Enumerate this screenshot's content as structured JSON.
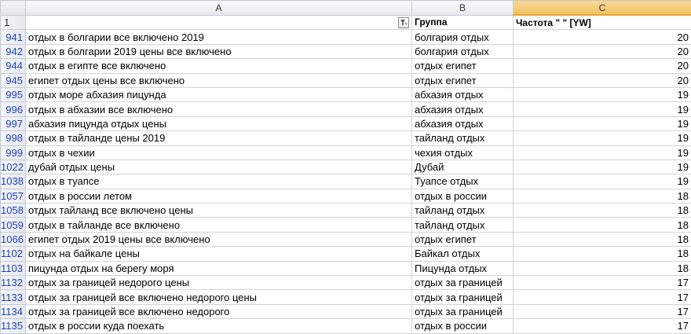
{
  "columns": [
    "A",
    "B",
    "C"
  ],
  "header_row": {
    "row_number": "1",
    "a": "",
    "b": "Группа",
    "c": "Частота \" \" [YW]"
  },
  "rows": [
    {
      "n": "941",
      "a": "отдых в болгарии все включено 2019",
      "b": "болгария отдых",
      "c": "20"
    },
    {
      "n": "942",
      "a": "отдых в болгарии 2019 цены все включено",
      "b": "болгария отдых",
      "c": "20"
    },
    {
      "n": "944",
      "a": "отдых в египте все включено",
      "b": "отдых египет",
      "c": "20"
    },
    {
      "n": "945",
      "a": "египет отдых цены все включено",
      "b": "отдых египет",
      "c": "20"
    },
    {
      "n": "995",
      "a": "отдых море абхазия пицунда",
      "b": "абхазия отдых",
      "c": "19"
    },
    {
      "n": "996",
      "a": "отдых в абхазии все включено",
      "b": "абхазия отдых",
      "c": "19"
    },
    {
      "n": "997",
      "a": "абхазия пицунда отдых цены",
      "b": "абхазия отдых",
      "c": "19"
    },
    {
      "n": "998",
      "a": "отдых в тайланде цены 2019",
      "b": "тайланд отдых",
      "c": "19"
    },
    {
      "n": "999",
      "a": "отдых в чехии",
      "b": "чехия отдых",
      "c": "19"
    },
    {
      "n": "1022",
      "a": "дубай отдых цены",
      "b": "Дубай",
      "c": "19"
    },
    {
      "n": "1038",
      "a": "отдых в туапсе",
      "b": "Туапсе отдых",
      "c": "19"
    },
    {
      "n": "1057",
      "a": "отдых в россии летом",
      "b": "отдых в россии",
      "c": "18"
    },
    {
      "n": "1058",
      "a": "отдых тайланд все включено цены",
      "b": "тайланд отдых",
      "c": "18"
    },
    {
      "n": "1059",
      "a": "отдых в тайланде все включено",
      "b": "тайланд отдых",
      "c": "18"
    },
    {
      "n": "1066",
      "a": "египет отдых 2019 цены все включено",
      "b": "отдых египет",
      "c": "18"
    },
    {
      "n": "1102",
      "a": "отдых на байкале цены",
      "b": "Байкал отдых",
      "c": "18"
    },
    {
      "n": "1103",
      "a": "пицунда отдых на берегу моря",
      "b": "Пицунда отдых",
      "c": "18"
    },
    {
      "n": "1132",
      "a": "отдых за границей недорого цены",
      "b": "отдых за границей",
      "c": "17"
    },
    {
      "n": "1133",
      "a": "отдых за границей все включено недорого цены",
      "b": "отдых за границей",
      "c": "17"
    },
    {
      "n": "1134",
      "a": "отдых за границей все включено недорого",
      "b": "отдых за границей",
      "c": "17"
    },
    {
      "n": "1135",
      "a": "отдых в россии куда поехать",
      "b": "отдых в россии",
      "c": "17"
    }
  ],
  "icons": {
    "filter": "filter-funnel-icon"
  },
  "colors": {
    "row_number_link": "#1f3fbf",
    "selected_column_header": "#f1c15f"
  }
}
